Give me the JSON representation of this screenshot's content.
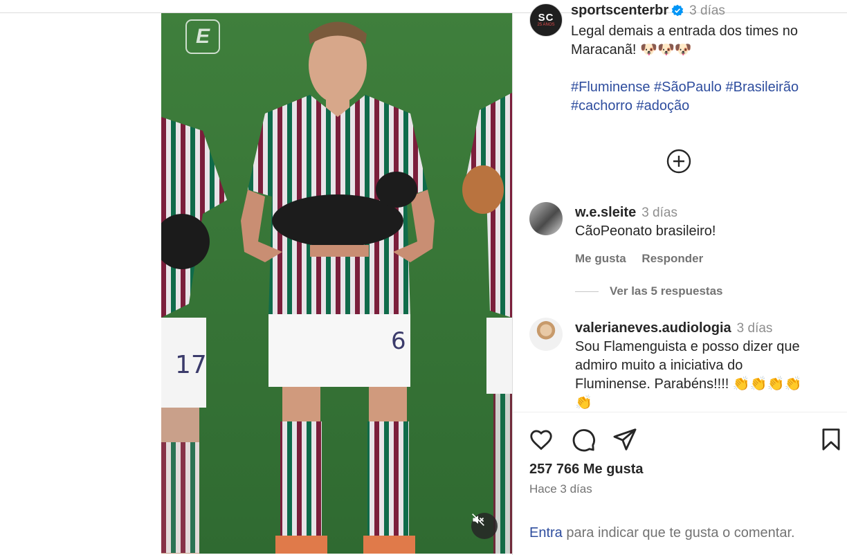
{
  "post": {
    "author": "sportscenterbr",
    "author_avatar_text": "SC",
    "author_avatar_sub": "25 ANOS",
    "time": "3 días",
    "caption_line1": "Legal demais a entrada dos times no",
    "caption_line2": "Maracanã! 🐶🐶🐶",
    "hashtags_line1": "#Fluminense #SãoPaulo #Brasileirão",
    "hashtags_line2": "#cachorro #adoção"
  },
  "comments": [
    {
      "username": "w.e.sleite",
      "time": "3 días",
      "text": "CãoPeonato brasileiro!",
      "like_label": "Me gusta",
      "reply_label": "Responder"
    },
    {
      "username": "valerianeves.audiologia",
      "time": "3 días",
      "text_line1": "Sou Flamenguista e posso dizer que",
      "text_line2": "admiro muito a iniciativa do",
      "text_line3": "Fluminense. Parabéns!!!! 👏👏👏👏",
      "text_line4": "👏"
    }
  ],
  "view_replies": "Ver las 5 respuestas",
  "likes": "257 766 Me gusta",
  "posted_ago": "Hace 3 días",
  "login_prompt": {
    "link": "Entra",
    "rest": " para indicar que te gusta o comentar."
  },
  "media": {
    "watermark_logo": "E"
  },
  "colors": {
    "link": "#2e4d9e",
    "muted": "#737373",
    "verified": "#0095f6"
  }
}
